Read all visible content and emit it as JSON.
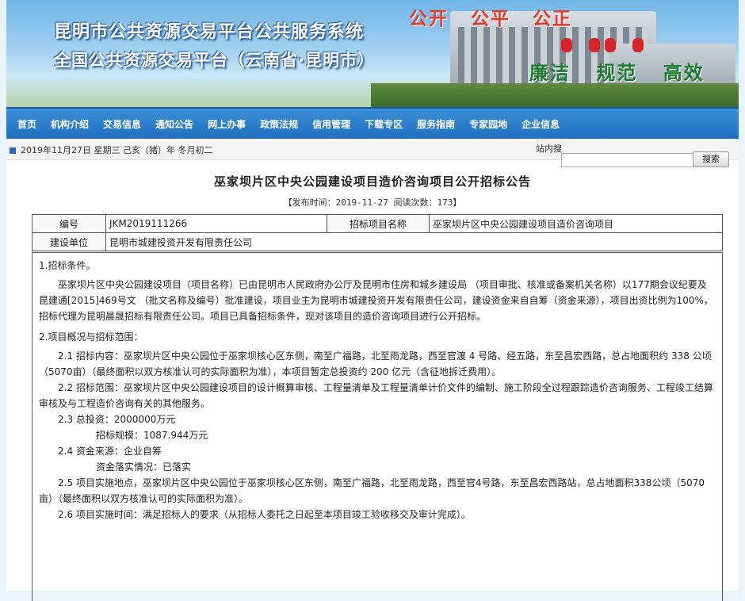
{
  "banner": {
    "title_line1": "昆明市公共资源交易平台公共服务系统",
    "title_line2": "全国公共资源交易平台（云南省·昆明市）",
    "slogan_top": "公开 公平 公正",
    "slogan_bottom": "廉洁 规范 高效"
  },
  "nav": [
    "首页",
    "机构介绍",
    "交易信息",
    "通知公告",
    "网上办事",
    "政策法规",
    "信用管理",
    "下载专区",
    "服务指南",
    "专家园地",
    "企业信息"
  ],
  "infobar": {
    "date": "2019年11月27日  星期三  己亥（猪）年 冬月初二",
    "search_label": "站内搜",
    "search_value": "",
    "search_button": "搜索"
  },
  "article": {
    "title": "巫家坝片区中央公园建设项目造价咨询项目公开招标公告",
    "meta": "【发布时间：2019-11-27  阅读次数：173】",
    "table": {
      "number_label": "编号",
      "number_value": "JKM2019111266",
      "project_label": "招标项目名称",
      "project_value": "巫家坝片区中央公园建设项目造价咨询项目",
      "owner_label": "建设单位",
      "owner_value": "昆明市城建投资开发有限责任公司"
    },
    "section1_title": "1.招标条件。",
    "section1_text": "巫家坝片区中央公园建设项目（项目名称）已由昆明市人民政府办公厅及昆明市住房和城乡建设局 （项目审批、核准或备案机关名称）以177期会议纪要及昆建通[2015]469号文 （批文名称及编号）批准建设，项目业主为昆明市城建投资开发有限责任公司，建设资金来自自筹（资金来源），项目出资比例为100%，招标代理为昆明晨晟招标有限责任公司。项目已具备招标条件，现对该项目的造价咨询项目进行公开招标。",
    "section2_title": "2.项目概况与招标范围：",
    "p21": "2.1 招标内容：巫家坝片区中央公园位于巫家坝核心区东侧，南至广福路，北至雨龙路，西至官渡 4 号路、经五路，东至昌宏西路，总占地面积约 338 公顷（5070亩）（最终面积以双方核准认可的实际面积为准），本项目暂定总投资约 200 亿元（含征地拆迁费用）。",
    "p22": "2.2 招标范围：巫家坝片区中央公园建设项目的设计概算审核、工程量清单及工程量清单计价文件的编制、施工阶段全过程跟踪造价咨询服务、工程竣工结算审核及与工程造价咨询有关的其他服务。",
    "p23a": "2.3 总投资：2000000万元",
    "p23b": "招标规模：1087.944万元",
    "p24a": "2.4 资金来源：企业自筹",
    "p24b": "资金落实情况：已落实",
    "p25": "2.5 项目实施地点，巫家坝片区中央公园位于巫家坝核心区东侧，南至广福路，北至雨龙路，西至官4号路，东至昌宏西路站，总占地面积338公顷（5070亩）（最终面积以双方核准认可的实际面积为准）。",
    "p26": "2.6 项目实施时间：满足招标人的要求（从招标人委托之日起至本项目竣工验收移交及审计完成）。"
  }
}
